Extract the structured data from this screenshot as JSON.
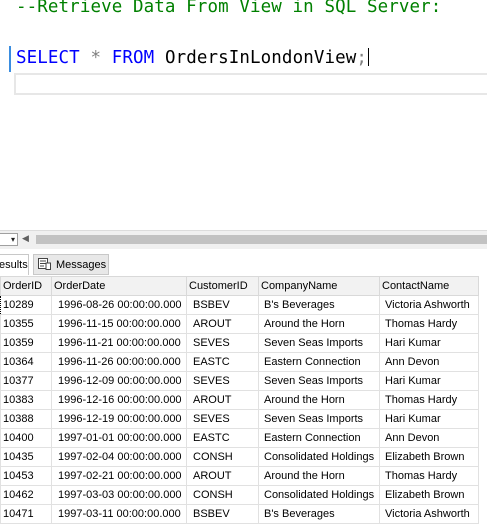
{
  "editor": {
    "comment_line": "--Retrieve Data From View in SQL Server:",
    "query": {
      "kw_select": "SELECT",
      "star": "*",
      "kw_from": "FROM",
      "view_name": "OrdersInLondonView",
      "terminator": ";"
    }
  },
  "scrollbar": {
    "zoom_caret": "▾",
    "left_arrow": "◀"
  },
  "tabs": {
    "results_label": "esults",
    "messages_label": "Messages"
  },
  "grid": {
    "columns": [
      "OrderID",
      "OrderDate",
      "CustomerID",
      "CompanyName",
      "ContactName"
    ],
    "rows": [
      [
        "10289",
        "1996-08-26 00:00:00.000",
        "BSBEV",
        "B's Beverages",
        "Victoria Ashworth"
      ],
      [
        "10355",
        "1996-11-15 00:00:00.000",
        "AROUT",
        "Around the Horn",
        "Thomas Hardy"
      ],
      [
        "10359",
        "1996-11-21 00:00:00.000",
        "SEVES",
        "Seven Seas Imports",
        "Hari Kumar"
      ],
      [
        "10364",
        "1996-11-26 00:00:00.000",
        "EASTC",
        "Eastern Connection",
        "Ann Devon"
      ],
      [
        "10377",
        "1996-12-09 00:00:00.000",
        "SEVES",
        "Seven Seas Imports",
        "Hari Kumar"
      ],
      [
        "10383",
        "1996-12-16 00:00:00.000",
        "AROUT",
        "Around the Horn",
        "Thomas Hardy"
      ],
      [
        "10388",
        "1996-12-19 00:00:00.000",
        "SEVES",
        "Seven Seas Imports",
        "Hari Kumar"
      ],
      [
        "10400",
        "1997-01-01 00:00:00.000",
        "EASTC",
        "Eastern Connection",
        "Ann Devon"
      ],
      [
        "10435",
        "1997-02-04 00:00:00.000",
        "CONSH",
        "Consolidated Holdings",
        "Elizabeth Brown"
      ],
      [
        "10453",
        "1997-02-21 00:00:00.000",
        "AROUT",
        "Around the Horn",
        "Thomas Hardy"
      ],
      [
        "10462",
        "1997-03-03 00:00:00.000",
        "CONSH",
        "Consolidated Holdings",
        "Elizabeth Brown"
      ],
      [
        "10471",
        "1997-03-11 00:00:00.000",
        "BSBEV",
        "B's Beverages",
        "Victoria Ashworth"
      ]
    ]
  },
  "colors": {
    "comment": "#008000",
    "keyword": "#0000ff",
    "operator": "#808080",
    "change_bar": "#3a8de0",
    "header_bg": "#f2f2f2"
  },
  "icons": {
    "messages": "messages-icon"
  }
}
